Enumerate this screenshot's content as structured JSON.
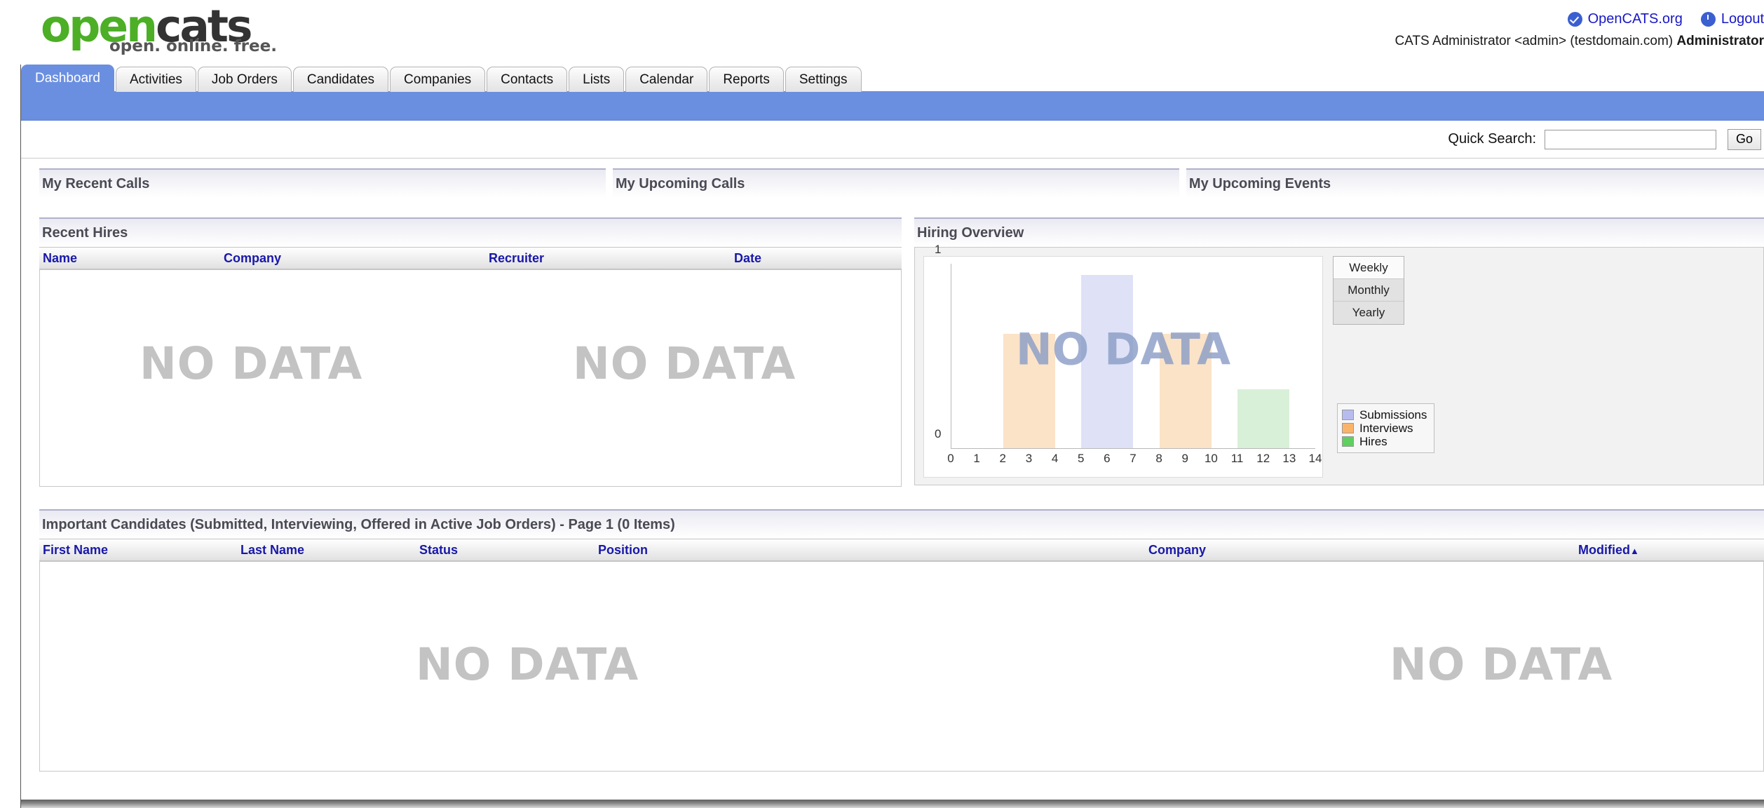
{
  "brand": {
    "logo_open": "open",
    "logo_cats": "cats",
    "tagline": "open. online. free.",
    "accent_green": "#4caf26",
    "nav_blue": "#6b8fe0"
  },
  "header": {
    "links": [
      {
        "label": "OpenCATS.org",
        "icon": "check-circle-icon"
      },
      {
        "label": "Logout",
        "icon": "power-circle-icon"
      }
    ],
    "user_line": "CATS Administrator <admin> (testdomain.com) ",
    "user_role": "Administrator"
  },
  "tabs": [
    {
      "label": "Dashboard",
      "active": true
    },
    {
      "label": "Activities",
      "active": false
    },
    {
      "label": "Job Orders",
      "active": false
    },
    {
      "label": "Candidates",
      "active": false
    },
    {
      "label": "Companies",
      "active": false
    },
    {
      "label": "Contacts",
      "active": false
    },
    {
      "label": "Lists",
      "active": false
    },
    {
      "label": "Calendar",
      "active": false
    },
    {
      "label": "Reports",
      "active": false
    },
    {
      "label": "Settings",
      "active": false
    }
  ],
  "search": {
    "label": "Quick Search:",
    "value": "",
    "placeholder": "",
    "go_label": "Go"
  },
  "call_panels": [
    {
      "title": "My Recent Calls"
    },
    {
      "title": "My Upcoming Calls"
    },
    {
      "title": "My Upcoming Events"
    }
  ],
  "recent_hires": {
    "title": "Recent Hires",
    "columns": [
      "Name",
      "Company",
      "Recruiter",
      "Date"
    ],
    "rows": [],
    "empty_text": "NO DATA"
  },
  "hiring_overview": {
    "title": "Hiring Overview",
    "range_buttons": [
      {
        "label": "Weekly",
        "selected": true
      },
      {
        "label": "Monthly",
        "selected": false
      },
      {
        "label": "Yearly",
        "selected": false
      }
    ],
    "empty_text": "NO DATA"
  },
  "important_candidates": {
    "title": "Important Candidates (Submitted, Interviewing, Offered in Active Job Orders) - Page 1 (0 Items)",
    "columns": [
      "First Name",
      "Last Name",
      "Status",
      "Position",
      "Company",
      "Modified"
    ],
    "sort_column": "Modified",
    "sort_arrow": "▲",
    "rows": [],
    "empty_text": "NO DATA"
  },
  "chart_data": {
    "type": "bar",
    "title": "Hiring Overview",
    "xlabel": "",
    "ylabel": "",
    "xlim": [
      0,
      14
    ],
    "ylim": [
      0,
      1
    ],
    "yticks": [
      0,
      1
    ],
    "xticks": [
      0,
      1,
      2,
      3,
      4,
      5,
      6,
      7,
      8,
      9,
      10,
      11,
      12,
      13,
      14
    ],
    "grid": false,
    "legend_position": "right",
    "has_data": false,
    "empty_overlay_text": "NO DATA",
    "legend": [
      {
        "name": "Submissions",
        "color": "#b7bcef"
      },
      {
        "name": "Interviews",
        "color": "#f9b46a"
      },
      {
        "name": "Hires",
        "color": "#5fd05f"
      }
    ],
    "placeholder_bars": [
      {
        "series": "Interviews",
        "x_start": 2,
        "x_end": 4,
        "height": 0.62,
        "color": "#fbe3c8"
      },
      {
        "series": "Submissions",
        "x_start": 5,
        "x_end": 7,
        "height": 0.94,
        "color": "#dfe1f7"
      },
      {
        "series": "Interviews",
        "x_start": 8,
        "x_end": 10,
        "height": 0.62,
        "color": "#fbe3c8"
      },
      {
        "series": "Hires",
        "x_start": 11,
        "x_end": 13,
        "height": 0.32,
        "color": "#d8f0d8"
      }
    ]
  }
}
